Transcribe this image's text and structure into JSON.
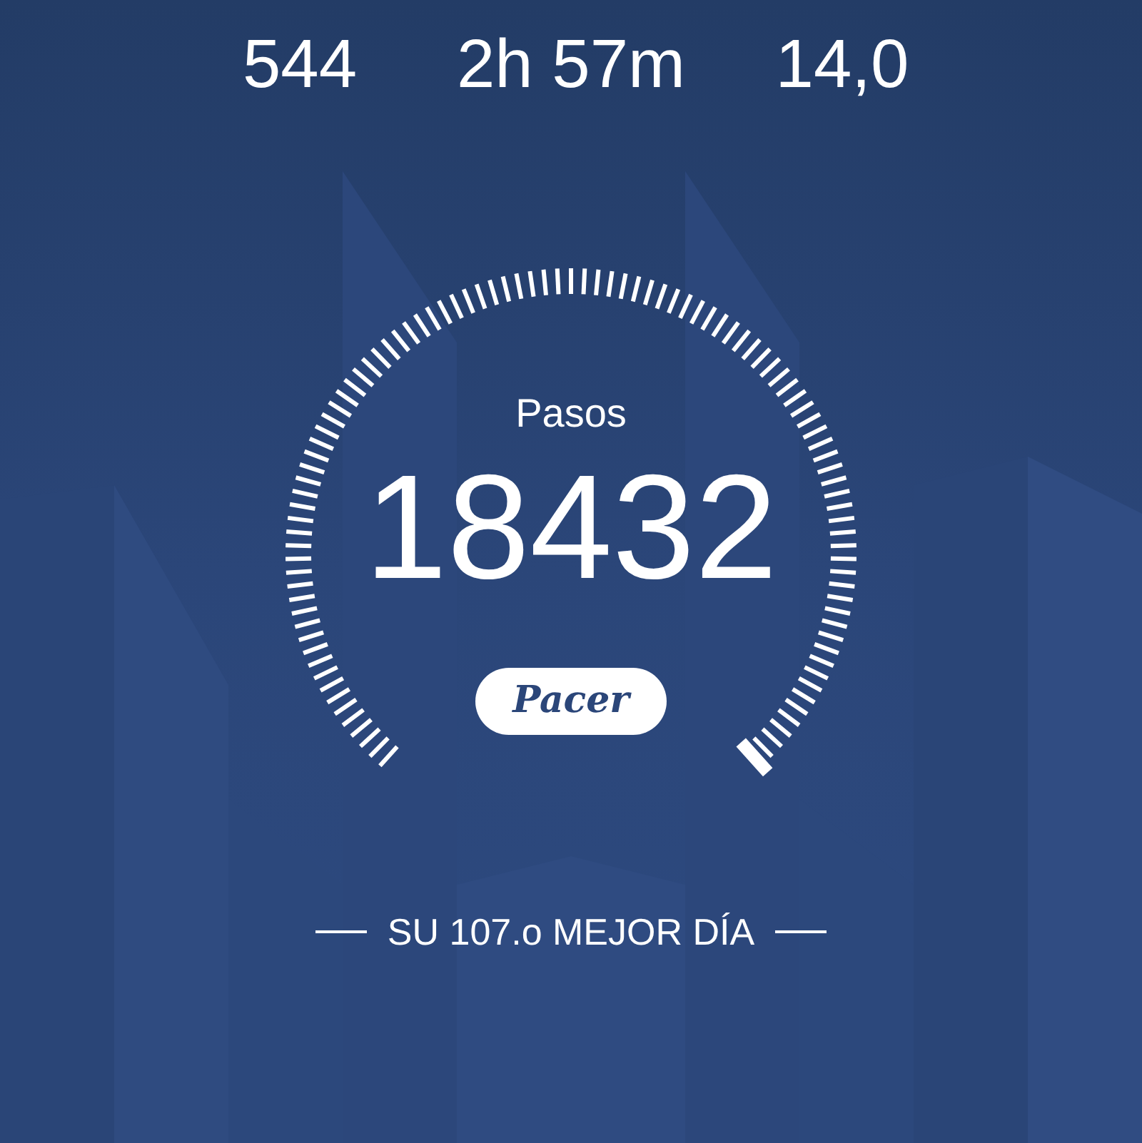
{
  "stats": [
    {
      "value": "544"
    },
    {
      "value": "2h 57m"
    },
    {
      "value": "14,0"
    }
  ],
  "steps": {
    "label": "Pasos",
    "value": "18432"
  },
  "brand": "Pacer",
  "rank": "SU 107.o MEJOR DÍA"
}
